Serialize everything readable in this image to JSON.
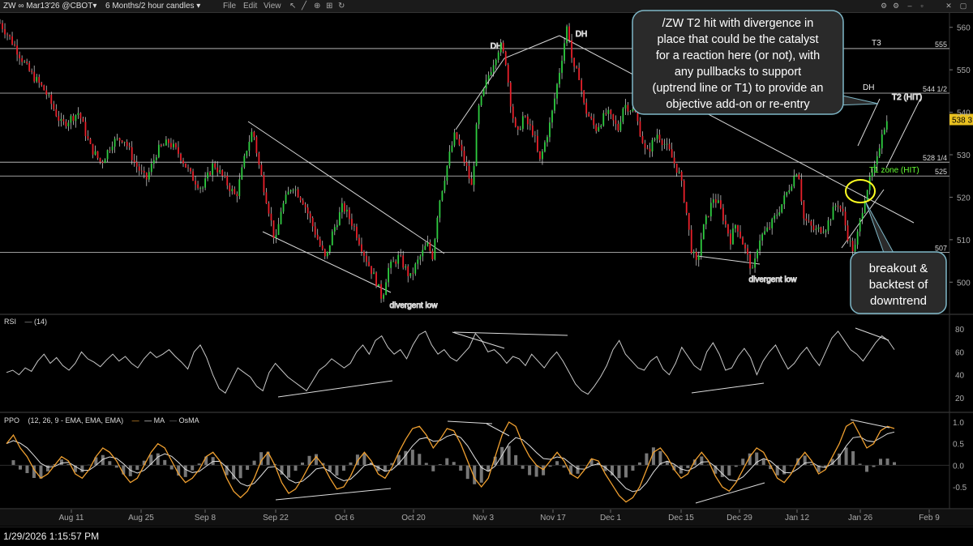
{
  "toolbar": {
    "symbol": "ZW ∞ Mar13'26 @CBOT▾",
    "period": "6 Months/2 hour candles ▾",
    "menu_file": "File",
    "menu_edit": "Edit",
    "menu_view": "View"
  },
  "status_time": "1/29/2026 1:15:57 PM",
  "colors": {
    "up": "#2ecc40",
    "down": "#e8202a",
    "rsi": "#c8c8c8",
    "ppo": "#f0a030",
    "signal": "#e0e0e0",
    "osma": "#777777",
    "annotation_bg": "#2a2a2a",
    "accent_green": "#66ff33",
    "callout_yellow": "#ffff22"
  },
  "chart_data": [
    {
      "type": "line",
      "panel": "price",
      "y_ticks": [
        "560",
        "550",
        "540",
        "530",
        "520",
        "510",
        "500"
      ],
      "ylim": [
        493,
        563
      ],
      "price_tag": "538 3",
      "x_labels": [
        "Aug 11",
        "Aug 25",
        "Sep 8",
        "Sep 22",
        "Oct 6",
        "Oct 20",
        "Nov 3",
        "Nov 17",
        "Dec 1",
        "Dec 15",
        "Dec 29",
        "Jan 12",
        "Jan 26",
        "Feb 9"
      ],
      "price_path": [
        [
          0,
          561
        ],
        [
          2,
          557
        ],
        [
          5,
          550
        ],
        [
          8,
          545
        ],
        [
          11,
          537
        ],
        [
          14,
          540
        ],
        [
          16,
          532
        ],
        [
          18,
          528
        ],
        [
          20,
          533
        ],
        [
          22,
          534
        ],
        [
          24,
          528
        ],
        [
          26,
          524
        ],
        [
          28,
          531
        ],
        [
          30,
          533
        ],
        [
          32,
          530
        ],
        [
          34,
          525
        ],
        [
          36,
          522
        ],
        [
          38,
          528
        ],
        [
          40,
          524
        ],
        [
          42,
          520
        ],
        [
          44,
          532
        ],
        [
          45,
          536
        ],
        [
          46,
          528
        ],
        [
          48,
          516
        ],
        [
          49,
          509
        ],
        [
          50,
          517
        ],
        [
          52,
          523
        ],
        [
          54,
          519
        ],
        [
          56,
          512
        ],
        [
          58,
          505
        ],
        [
          59,
          511
        ],
        [
          61,
          518
        ],
        [
          63,
          513
        ],
        [
          65,
          506
        ],
        [
          67,
          500
        ],
        [
          68,
          496
        ],
        [
          69,
          503
        ],
        [
          71,
          506
        ],
        [
          73,
          501
        ],
        [
          74,
          504
        ],
        [
          76,
          509
        ],
        [
          77,
          506
        ],
        [
          78,
          518
        ],
        [
          80,
          530
        ],
        [
          81,
          535
        ],
        [
          82,
          531
        ],
        [
          83,
          527
        ],
        [
          84,
          522
        ],
        [
          85,
          540
        ],
        [
          87,
          549
        ],
        [
          89,
          556
        ],
        [
          90,
          552
        ],
        [
          91,
          541
        ],
        [
          92,
          534
        ],
        [
          93,
          539
        ],
        [
          95,
          535
        ],
        [
          96,
          528
        ],
        [
          98,
          538
        ],
        [
          100,
          553
        ],
        [
          101,
          561
        ],
        [
          102,
          550
        ],
        [
          103,
          549
        ],
        [
          104,
          541
        ],
        [
          106,
          536
        ],
        [
          108,
          540
        ],
        [
          110,
          536
        ],
        [
          111,
          542
        ],
        [
          113,
          540
        ],
        [
          115,
          530
        ],
        [
          117,
          535
        ],
        [
          119,
          531
        ],
        [
          121,
          525
        ],
        [
          122,
          518
        ],
        [
          123,
          508
        ],
        [
          124,
          504
        ],
        [
          125,
          512
        ],
        [
          127,
          520
        ],
        [
          128,
          518
        ],
        [
          130,
          510
        ],
        [
          131,
          514
        ],
        [
          133,
          506
        ],
        [
          134,
          502
        ],
        [
          135,
          510
        ],
        [
          137,
          513
        ],
        [
          139,
          518
        ],
        [
          141,
          524
        ],
        [
          142,
          527
        ],
        [
          143,
          515
        ],
        [
          145,
          512
        ],
        [
          147,
          513
        ],
        [
          149,
          519
        ],
        [
          150,
          516
        ],
        [
          151,
          510
        ],
        [
          152,
          507
        ],
        [
          154,
          521
        ],
        [
          156,
          528
        ],
        [
          157,
          536
        ],
        [
          158,
          538
        ]
      ],
      "levels": [
        {
          "label": "T3",
          "tag": "555",
          "value": 555
        },
        {
          "label": "DH",
          "tag": "544 1/2",
          "value": 544.5
        },
        {
          "label": "",
          "tag": "528 1/4",
          "value": 528.25
        },
        {
          "label": "T1 zone (HIT)",
          "tag": "525",
          "value": 525
        },
        {
          "label": "",
          "tag": "507",
          "value": 507
        }
      ],
      "labels": {
        "dh1": "DH",
        "dh2": "DH",
        "t2": "T2 (HIT)",
        "div_low_1": "divergent low",
        "div_low_2": "divergent low"
      },
      "annotation_main": "/ZW T2 hit with divergence in place that could be the catalyst for a reaction here (or not), with any pullbacks to support (uptrend line or T1) to provide an objective add-on or re-entry",
      "annotation_breakout": "breakout & backtest of downtrend"
    },
    {
      "type": "line",
      "panel": "rsi",
      "title": "RSI",
      "params": "(14)",
      "ylim": [
        10,
        90
      ],
      "y_ticks": [
        "80",
        "60",
        "40",
        "20"
      ],
      "values": [
        42,
        44,
        40,
        46,
        43,
        52,
        58,
        50,
        55,
        48,
        44,
        50,
        60,
        54,
        51,
        47,
        53,
        58,
        52,
        56,
        50,
        46,
        54,
        60,
        55,
        58,
        62,
        56,
        51,
        45,
        60,
        66,
        55,
        40,
        28,
        24,
        35,
        46,
        42,
        38,
        30,
        26,
        42,
        50,
        44,
        38,
        34,
        30,
        26,
        35,
        44,
        48,
        54,
        50,
        46,
        50,
        60,
        66,
        58,
        70,
        74,
        64,
        58,
        62,
        54,
        66,
        75,
        78,
        66,
        58,
        62,
        55,
        52,
        58,
        64,
        76,
        70,
        60,
        62,
        57,
        50,
        56,
        54,
        48,
        58,
        52,
        46,
        54,
        60,
        52,
        42,
        32,
        26,
        23,
        30,
        38,
        48,
        62,
        70,
        58,
        52,
        46,
        44,
        52,
        56,
        45,
        40,
        50,
        64,
        56,
        48,
        44,
        60,
        68,
        58,
        44,
        46,
        56,
        63,
        55,
        40,
        52,
        60,
        66,
        55,
        45,
        50,
        58,
        64,
        55,
        48,
        60,
        72,
        78,
        70,
        62,
        58,
        52,
        60,
        68,
        74,
        70,
        62
      ]
    },
    {
      "type": "line",
      "panel": "ppo",
      "title": "PPO",
      "params": "(12, 26, 9 - EMA, EMA, EMA)",
      "legend_ma": "MA",
      "legend_osma": "OsMA",
      "ylim": [
        -0.95,
        1.15
      ],
      "y_ticks": [
        "1.0",
        "0.5",
        "0.0",
        "-0.5"
      ],
      "values": [
        0.5,
        0.7,
        0.4,
        0.2,
        -0.1,
        -0.3,
        -0.2,
        0.0,
        0.2,
        0.1,
        -0.2,
        -0.3,
        -0.1,
        0.2,
        0.4,
        0.3,
        0.1,
        -0.2,
        -0.4,
        -0.3,
        0.0,
        0.3,
        0.5,
        0.4,
        0.1,
        -0.2,
        -0.4,
        -0.3,
        -0.1,
        0.2,
        0.3,
        0.1,
        -0.3,
        -0.6,
        -0.75,
        -0.6,
        -0.3,
        0.1,
        0.3,
        0.0,
        -0.4,
        -0.65,
        -0.55,
        -0.3,
        0.0,
        0.2,
        0.0,
        -0.3,
        -0.55,
        -0.5,
        -0.25,
        0.1,
        0.3,
        0.1,
        -0.2,
        -0.3,
        -0.05,
        0.3,
        0.6,
        0.85,
        0.9,
        0.7,
        0.4,
        0.6,
        0.85,
        0.8,
        0.5,
        0.1,
        -0.3,
        -0.5,
        -0.3,
        0.2,
        0.7,
        1.0,
        0.9,
        0.5,
        0.2,
        0.0,
        -0.1,
        0.1,
        0.3,
        0.1,
        -0.2,
        -0.3,
        -0.1,
        0.15,
        0.1,
        -0.2,
        -0.45,
        -0.7,
        -0.85,
        -0.75,
        -0.5,
        -0.1,
        0.3,
        0.4,
        0.2,
        -0.1,
        -0.3,
        -0.2,
        0.1,
        0.3,
        0.1,
        -0.25,
        -0.5,
        -0.6,
        -0.4,
        -0.1,
        0.2,
        0.4,
        0.3,
        0.0,
        -0.3,
        -0.4,
        -0.2,
        0.1,
        0.3,
        0.1,
        -0.2,
        -0.1,
        0.2,
        0.5,
        0.9,
        1.0,
        0.7,
        0.4,
        0.5,
        0.8,
        0.9,
        0.85
      ]
    }
  ]
}
